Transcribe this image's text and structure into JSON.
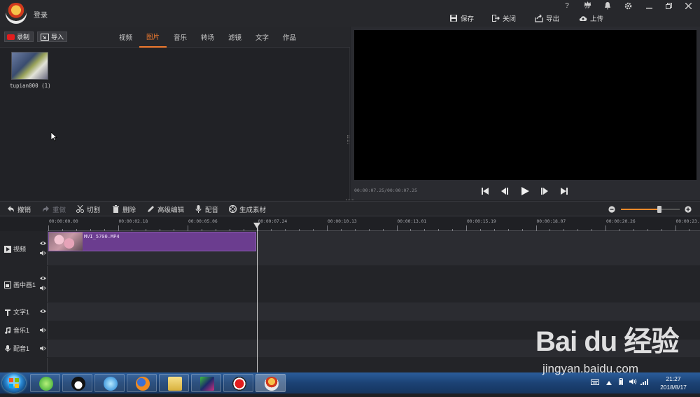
{
  "titlebar": {
    "login": "登录",
    "help": "?",
    "vip": "VIP",
    "save": "保存",
    "close": "关闭",
    "export": "导出",
    "upload": "上传"
  },
  "media": {
    "record": "录制",
    "import": "导入",
    "tabs": [
      "视频",
      "图片",
      "音乐",
      "转场",
      "滤镜",
      "文字",
      "作品"
    ],
    "active_tab": "图片",
    "thumb_label": "tupian000 (1)"
  },
  "preview": {
    "timecode": "00:00:07.25/00:00:07.25"
  },
  "edit_toolbar": {
    "undo": "撤销",
    "redo": "重做",
    "cut": "切割",
    "delete": "删除",
    "advanced": "高级编辑",
    "dub": "配音",
    "generate": "生成素材"
  },
  "zoom": {
    "level": 0.65
  },
  "ruler": {
    "labels": [
      "00:00:00.00",
      "00:00:02.18",
      "00:00:05.06",
      "00:00:07.24",
      "00:00:10.13",
      "00:00:13.01",
      "00:00:15.19",
      "00:00:18.07",
      "00:00:20.26",
      "00:00:23."
    ]
  },
  "tracks": {
    "video": "视频",
    "pip": "画中画1",
    "text": "文字1",
    "music": "音乐1",
    "voice": "配音1",
    "clip_label": "MVI_5700.MP4"
  },
  "taskbar": {
    "time": "21:27",
    "date": "2018/8/17"
  },
  "watermark": {
    "brand": "Bai du 经验",
    "url": "jingyan.baidu.com"
  },
  "colors": {
    "accent": "#ee7a2f",
    "clip": "#6b3d8f",
    "record": "#e21d1d"
  }
}
